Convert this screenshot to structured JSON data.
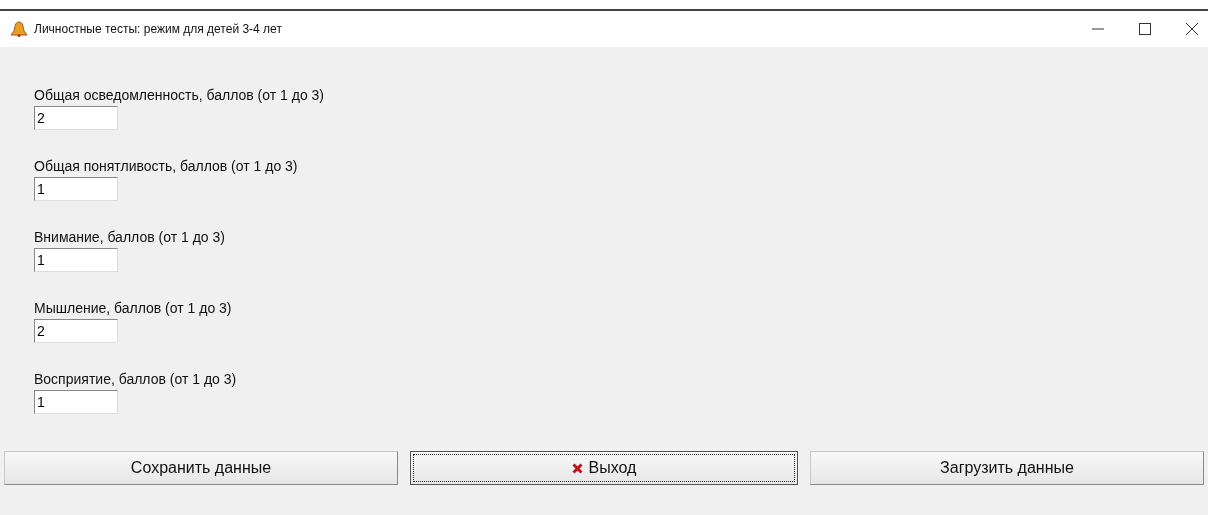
{
  "window": {
    "title": "Личностные тесты: режим для детей 3-4 лет"
  },
  "fields": [
    {
      "label": "Общая осведомленность, баллов (от 1 до 3)",
      "value": "2"
    },
    {
      "label": "Общая понятливость, баллов (от 1 до 3)",
      "value": "1"
    },
    {
      "label": "Внимание, баллов (от 1 до 3)",
      "value": "1"
    },
    {
      "label": "Мышление, баллов (от 1 до 3)",
      "value": "2"
    },
    {
      "label": "Восприятие, баллов (от 1 до 3)",
      "value": "1"
    }
  ],
  "buttons": [
    {
      "label": "Сохранить данные",
      "focused": false,
      "kind": "plain"
    },
    {
      "label": "Выход",
      "focused": true,
      "kind": "exit"
    },
    {
      "label": "Загрузить данные",
      "focused": false,
      "kind": "plain"
    }
  ]
}
